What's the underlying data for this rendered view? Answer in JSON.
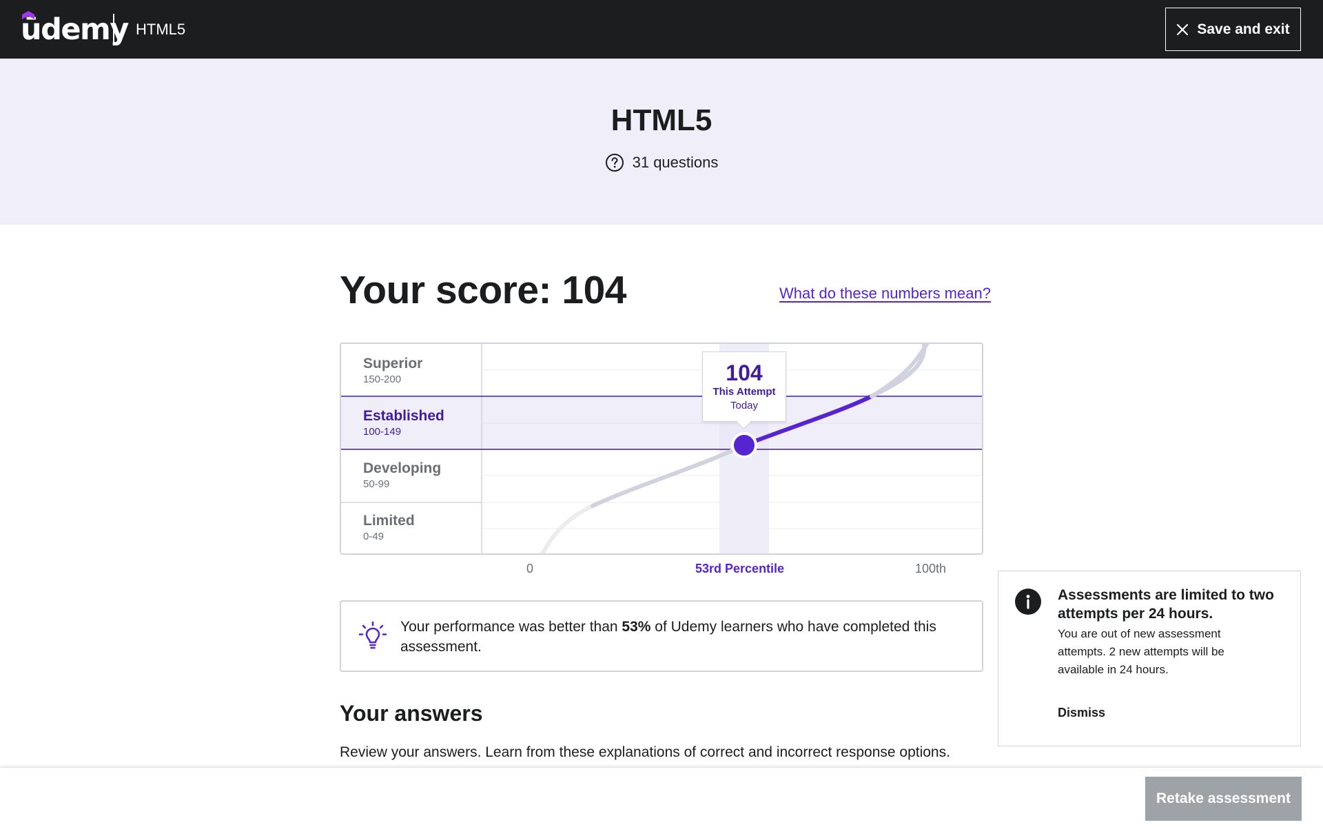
{
  "topbar": {
    "logo_text": "ūdemy",
    "course_title": "HTML5",
    "save_exit_label": "Save and exit"
  },
  "hero": {
    "title": "HTML5",
    "question_count": "31 questions"
  },
  "score": {
    "title": "Your score: 104",
    "value": 104,
    "help_link": "What do these numbers mean?"
  },
  "chart": {
    "bands": [
      {
        "name": "Superior",
        "range": "150-200"
      },
      {
        "name": "Established",
        "range": "100-149"
      },
      {
        "name": "Developing",
        "range": "50-99"
      },
      {
        "name": "Limited",
        "range": "0-49"
      }
    ],
    "active_band": "Established",
    "tooltip_score": "104",
    "tooltip_label": "This Attempt",
    "tooltip_when": "Today",
    "axis_left": "0",
    "axis_mid": "53rd Percentile",
    "axis_right": "100th",
    "percentile": 53
  },
  "insight": {
    "prefix": "Your performance was better than ",
    "highlight": "53%",
    "suffix": " of Udemy learners who have completed this assessment."
  },
  "answers": {
    "title": "Your answers",
    "description": "Review your answers. Learn from these explanations of correct and incorrect response options."
  },
  "notice": {
    "title": "Assessments are limited to two attempts per 24 hours.",
    "body": "You are out of new assessment attempts. 2 new attempts will be available in 24 hours.",
    "dismiss_label": "Dismiss"
  },
  "bottombar": {
    "retake_label": "Retake assessment"
  },
  "colors": {
    "brand_purple": "#5624d0",
    "dark_purple": "#401b9c",
    "topbar_bg": "#1c1d1f",
    "hero_bg": "#f0eff9",
    "disabled_button": "#9da3a7"
  },
  "icons": {
    "logo": "udemy-logo",
    "close": "close-icon",
    "question": "question-circle-icon",
    "insight": "lightbulb-icon",
    "info": "info-icon"
  }
}
